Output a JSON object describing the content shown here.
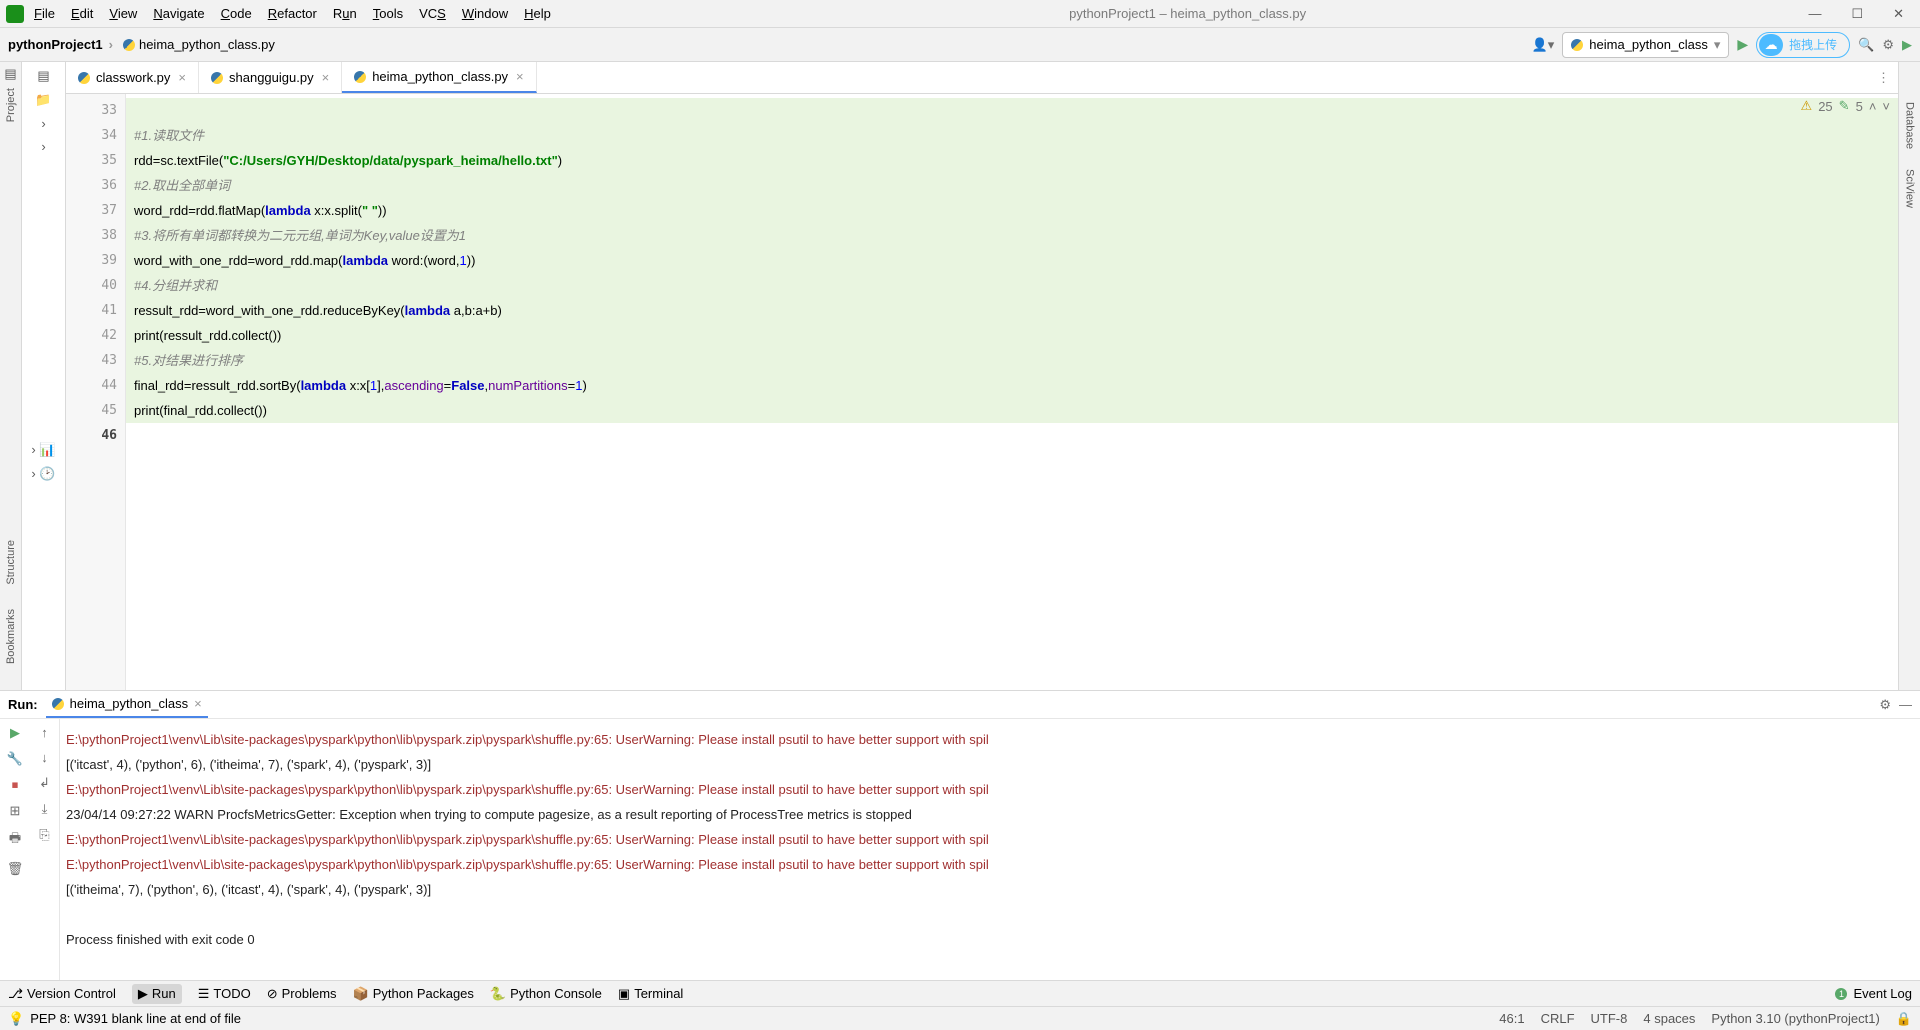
{
  "window": {
    "title": "pythonProject1 – heima_python_class.py"
  },
  "menubar": [
    "File",
    "Edit",
    "View",
    "Navigate",
    "Code",
    "Refactor",
    "Run",
    "Tools",
    "VCS",
    "Window",
    "Help"
  ],
  "breadcrumb": {
    "project": "pythonProject1",
    "file": "heima_python_class.py"
  },
  "runcfg": {
    "name": "heima_python_class"
  },
  "cloudButton": "拖拽上传",
  "tabs": [
    {
      "name": "classwork.py",
      "active": false
    },
    {
      "name": "shangguigu.py",
      "active": false
    },
    {
      "name": "heima_python_class.py",
      "active": true
    }
  ],
  "inspections": {
    "warnings": "25",
    "typos": "5"
  },
  "code": {
    "start": 33,
    "lines": [
      {
        "n": 33,
        "raw": ""
      },
      {
        "n": 34,
        "raw": "#1.读取文件",
        "comment": true
      },
      {
        "n": 35,
        "pre": "rdd=sc.textFile(",
        "str": "\"C:/Users/GYH/Desktop/data/pyspark_heima/hello.txt\"",
        "post": ")"
      },
      {
        "n": 36,
        "raw": "#2.取出全部单词",
        "comment": true
      },
      {
        "n": 37,
        "pre": "word_rdd=rdd.flatMap(",
        "kw": "lambda",
        "mid": " x:x.split(",
        "str": "\" \"",
        "post": "))"
      },
      {
        "n": 38,
        "raw": "#3.将所有单词都转换为二元元组,单词为Key,value设置为1",
        "comment": true
      },
      {
        "n": 39,
        "pre": "word_with_one_rdd=word_rdd.map(",
        "kw": "lambda",
        "mid": " word:(word,",
        "num": "1",
        "post": "))"
      },
      {
        "n": 40,
        "raw": "#4.分组并求和",
        "comment": true
      },
      {
        "n": 41,
        "pre": "ressult_rdd=word_with_one_rdd.reduceByKey(",
        "kw": "lambda",
        "post": " a,b:a+b)"
      },
      {
        "n": 42,
        "raw": "print(ressult_rdd.collect())"
      },
      {
        "n": 43,
        "raw": "#5.对结果进行排序",
        "comment": true
      },
      {
        "n": 44,
        "segs": [
          {
            "t": "final_rdd=ressult_rdd.sortBy("
          },
          {
            "kw": "lambda"
          },
          {
            "t": " x:x["
          },
          {
            "num": "1"
          },
          {
            "t": "],"
          },
          {
            "arg": "ascending"
          },
          {
            "t": "="
          },
          {
            "kw": "False"
          },
          {
            "t": ","
          },
          {
            "arg": "numPartitions"
          },
          {
            "t": "="
          },
          {
            "num": "1"
          },
          {
            "t": ")"
          }
        ]
      },
      {
        "n": 45,
        "raw": "print(final_rdd.collect())"
      },
      {
        "n": 46,
        "raw": "",
        "last": true
      }
    ]
  },
  "run": {
    "label": "Run:",
    "tab": "heima_python_class",
    "lines": [
      {
        "cls": "warn",
        "t": "E:\\pythonProject1\\venv\\Lib\\site-packages\\pyspark\\python\\lib\\pyspark.zip\\pyspark\\shuffle.py:65: UserWarning: Please install psutil to have better support with spil"
      },
      {
        "cls": "out",
        "t": "[('itcast', 4), ('python', 6), ('itheima', 7), ('spark', 4), ('pyspark', 3)]"
      },
      {
        "cls": "warn",
        "t": "E:\\pythonProject1\\venv\\Lib\\site-packages\\pyspark\\python\\lib\\pyspark.zip\\pyspark\\shuffle.py:65: UserWarning: Please install psutil to have better support with spil"
      },
      {
        "cls": "out",
        "t": "23/04/14 09:27:22 WARN ProcfsMetricsGetter: Exception when trying to compute pagesize, as a result reporting of ProcessTree metrics is stopped"
      },
      {
        "cls": "warn",
        "t": "E:\\pythonProject1\\venv\\Lib\\site-packages\\pyspark\\python\\lib\\pyspark.zip\\pyspark\\shuffle.py:65: UserWarning: Please install psutil to have better support with spil"
      },
      {
        "cls": "warn",
        "t": "E:\\pythonProject1\\venv\\Lib\\site-packages\\pyspark\\python\\lib\\pyspark.zip\\pyspark\\shuffle.py:65: UserWarning: Please install psutil to have better support with spil"
      },
      {
        "cls": "out",
        "t": "[('itheima', 7), ('python', 6), ('itcast', 4), ('spark', 4), ('pyspark', 3)]"
      },
      {
        "cls": "out",
        "t": ""
      },
      {
        "cls": "out",
        "t": "Process finished with exit code 0"
      }
    ]
  },
  "sidetools": {
    "project": "Project",
    "structure": "Structure",
    "bookmarks": "Bookmarks",
    "database": "Database",
    "sciview": "SciView"
  },
  "bottombar": [
    {
      "icon": "⎇",
      "label": "Version Control"
    },
    {
      "icon": "▶",
      "label": "Run",
      "active": true
    },
    {
      "icon": "☰",
      "label": "TODO"
    },
    {
      "icon": "⊘",
      "label": "Problems"
    },
    {
      "icon": "📦",
      "label": "Python Packages"
    },
    {
      "icon": "🐍",
      "label": "Python Console"
    },
    {
      "icon": "▣",
      "label": "Terminal"
    }
  ],
  "eventlog": {
    "count": "1",
    "label": "Event Log"
  },
  "status": {
    "pep": "PEP 8: W391 blank line at end of file",
    "pos": "46:1",
    "lineend": "CRLF",
    "enc": "UTF-8",
    "indent": "4 spaces",
    "interp": "Python 3.10 (pythonProject1)"
  }
}
